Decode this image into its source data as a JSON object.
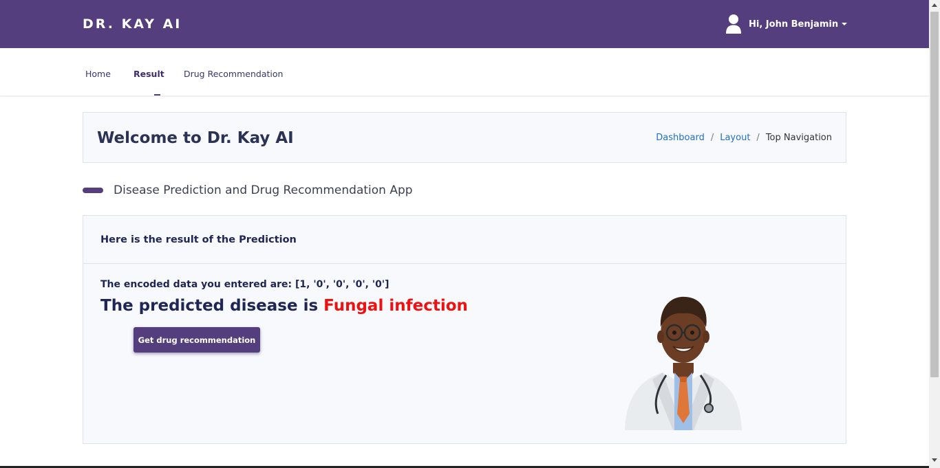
{
  "brand": "DR. KAY AI",
  "user": {
    "greeting": "Hi, John Benjamin",
    "icon": "user-icon"
  },
  "nav": {
    "items": [
      {
        "label": "Home",
        "active": false
      },
      {
        "label": "Result",
        "active": true
      },
      {
        "label": "Drug Recommendation",
        "active": false
      }
    ]
  },
  "welcome": {
    "title": "Welcome to Dr. Kay AI",
    "breadcrumb": [
      "Dashboard",
      "Layout",
      "Top Navigation"
    ]
  },
  "section_title": "Disease Prediction and Drug Recommendation App",
  "result": {
    "header": "Here is the result of the Prediction",
    "encoded_text": "The encoded data you entered are: [1, '0', '0', '0', '0']",
    "predicted_prefix": "The predicted disease is ",
    "predicted_disease": "Fungal infection",
    "button_label": "Get drug recommendation"
  },
  "colors": {
    "primary": "#553e7d",
    "disease": "#ee1111",
    "link": "#1f6fc8",
    "heading": "#1f2555"
  }
}
